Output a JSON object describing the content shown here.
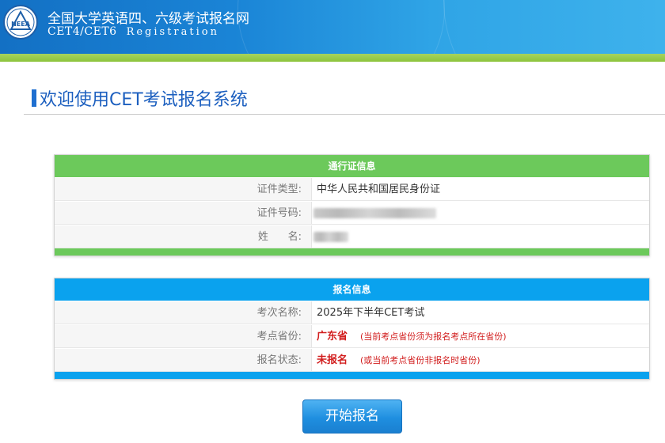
{
  "header": {
    "title": "全国大学英语四、六级考试报名网",
    "subtitle_cet": "CET4/CET6",
    "subtitle_registration": "Registration",
    "logo_text": "NEEA"
  },
  "welcome": {
    "heading": "欢迎使用CET考试报名系统"
  },
  "pass_info": {
    "title": "通行证信息",
    "rows": [
      {
        "label": "证件类型:",
        "value": "中华人民共和国居民身份证"
      },
      {
        "label": "证件号码:",
        "value": ""
      },
      {
        "label": "姓      名:",
        "value": ""
      }
    ]
  },
  "registration_info": {
    "title": "报名信息",
    "rows": [
      {
        "label": "考次名称:",
        "value": "2025年下半年CET考试"
      },
      {
        "label": "考点省份:",
        "value": "广东省",
        "note": "(当前考点省份须为报名考点所在省份)"
      },
      {
        "label": "报名状态:",
        "value": "未报名",
        "note": "(或当前考点省份非报名时省份)"
      }
    ]
  },
  "actions": {
    "start_label": "开始报名"
  },
  "colors": {
    "header_blue": "#1a84d6",
    "header_stripe_green": "#8cc43c",
    "panel_green": "#6cc95b",
    "panel_blue": "#0aa2ee",
    "heading_blue": "#1c5fbf",
    "alert_red": "#d21e1e"
  }
}
